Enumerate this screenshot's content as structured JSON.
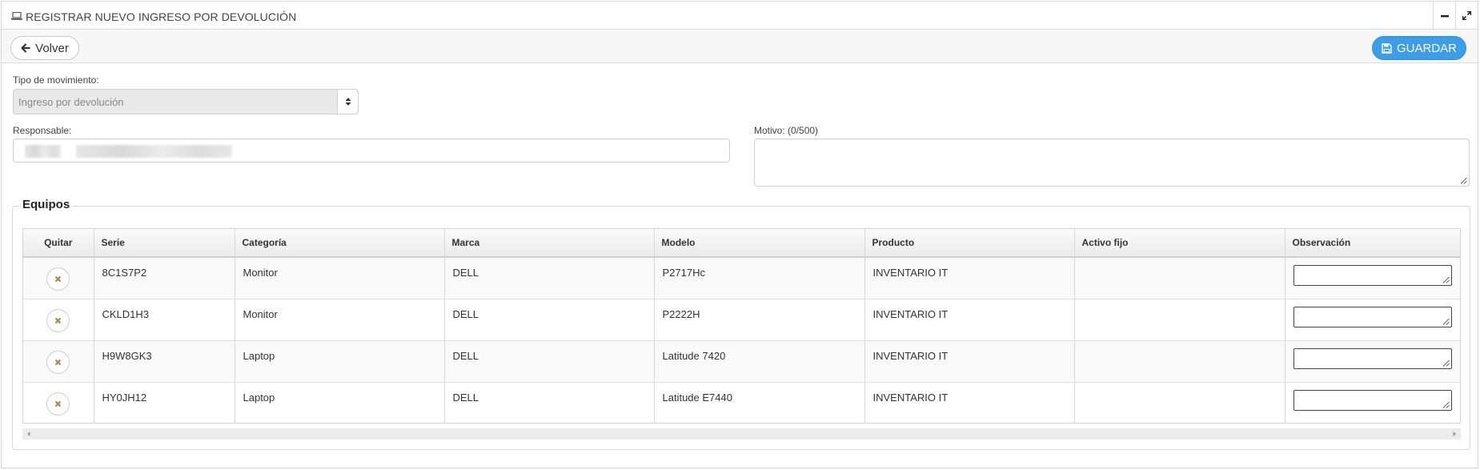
{
  "window": {
    "title": "REGISTRAR NUEVO INGRESO POR DEVOLUCIÓN",
    "title_icon": "laptop-icon",
    "minimize_icon": "minus-icon",
    "maximize_icon": "expand-icon"
  },
  "toolbar": {
    "back_label": "Volver",
    "back_icon": "arrow-left-icon",
    "save_label": "GUARDAR",
    "save_icon": "floppy-disk-icon",
    "save_color": "#3c9de8"
  },
  "form": {
    "tipo_label": "Tipo de movimiento:",
    "tipo_value": "Ingreso por devolución",
    "responsable_label": "Responsable:",
    "motivo_label": "Motivo: (0/500)"
  },
  "equipos": {
    "legend": "Equipos",
    "columns": [
      "Quitar",
      "Serie",
      "Categoría",
      "Marca",
      "Modelo",
      "Producto",
      "Activo fijo",
      "Observación"
    ],
    "rows": [
      {
        "serie": "8C1S7P2",
        "categoria": "Monitor",
        "marca": "DELL",
        "modelo": "P2717Hc",
        "producto": "INVENTARIO IT",
        "activo_fijo": ""
      },
      {
        "serie": "CKLD1H3",
        "categoria": "Monitor",
        "marca": "DELL",
        "modelo": "P2222H",
        "producto": "INVENTARIO IT",
        "activo_fijo": ""
      },
      {
        "serie": "H9W8GK3",
        "categoria": "Laptop",
        "marca": "DELL",
        "modelo": "Latitude 7420",
        "producto": "INVENTARIO IT",
        "activo_fijo": ""
      },
      {
        "serie": "HY0JH12",
        "categoria": "Laptop",
        "marca": "DELL",
        "modelo": "Latitude E7440",
        "producto": "INVENTARIO IT",
        "activo_fijo": ""
      }
    ],
    "remove_icon": "remove-x-icon",
    "remove_icon_color": "#a08a5a"
  }
}
